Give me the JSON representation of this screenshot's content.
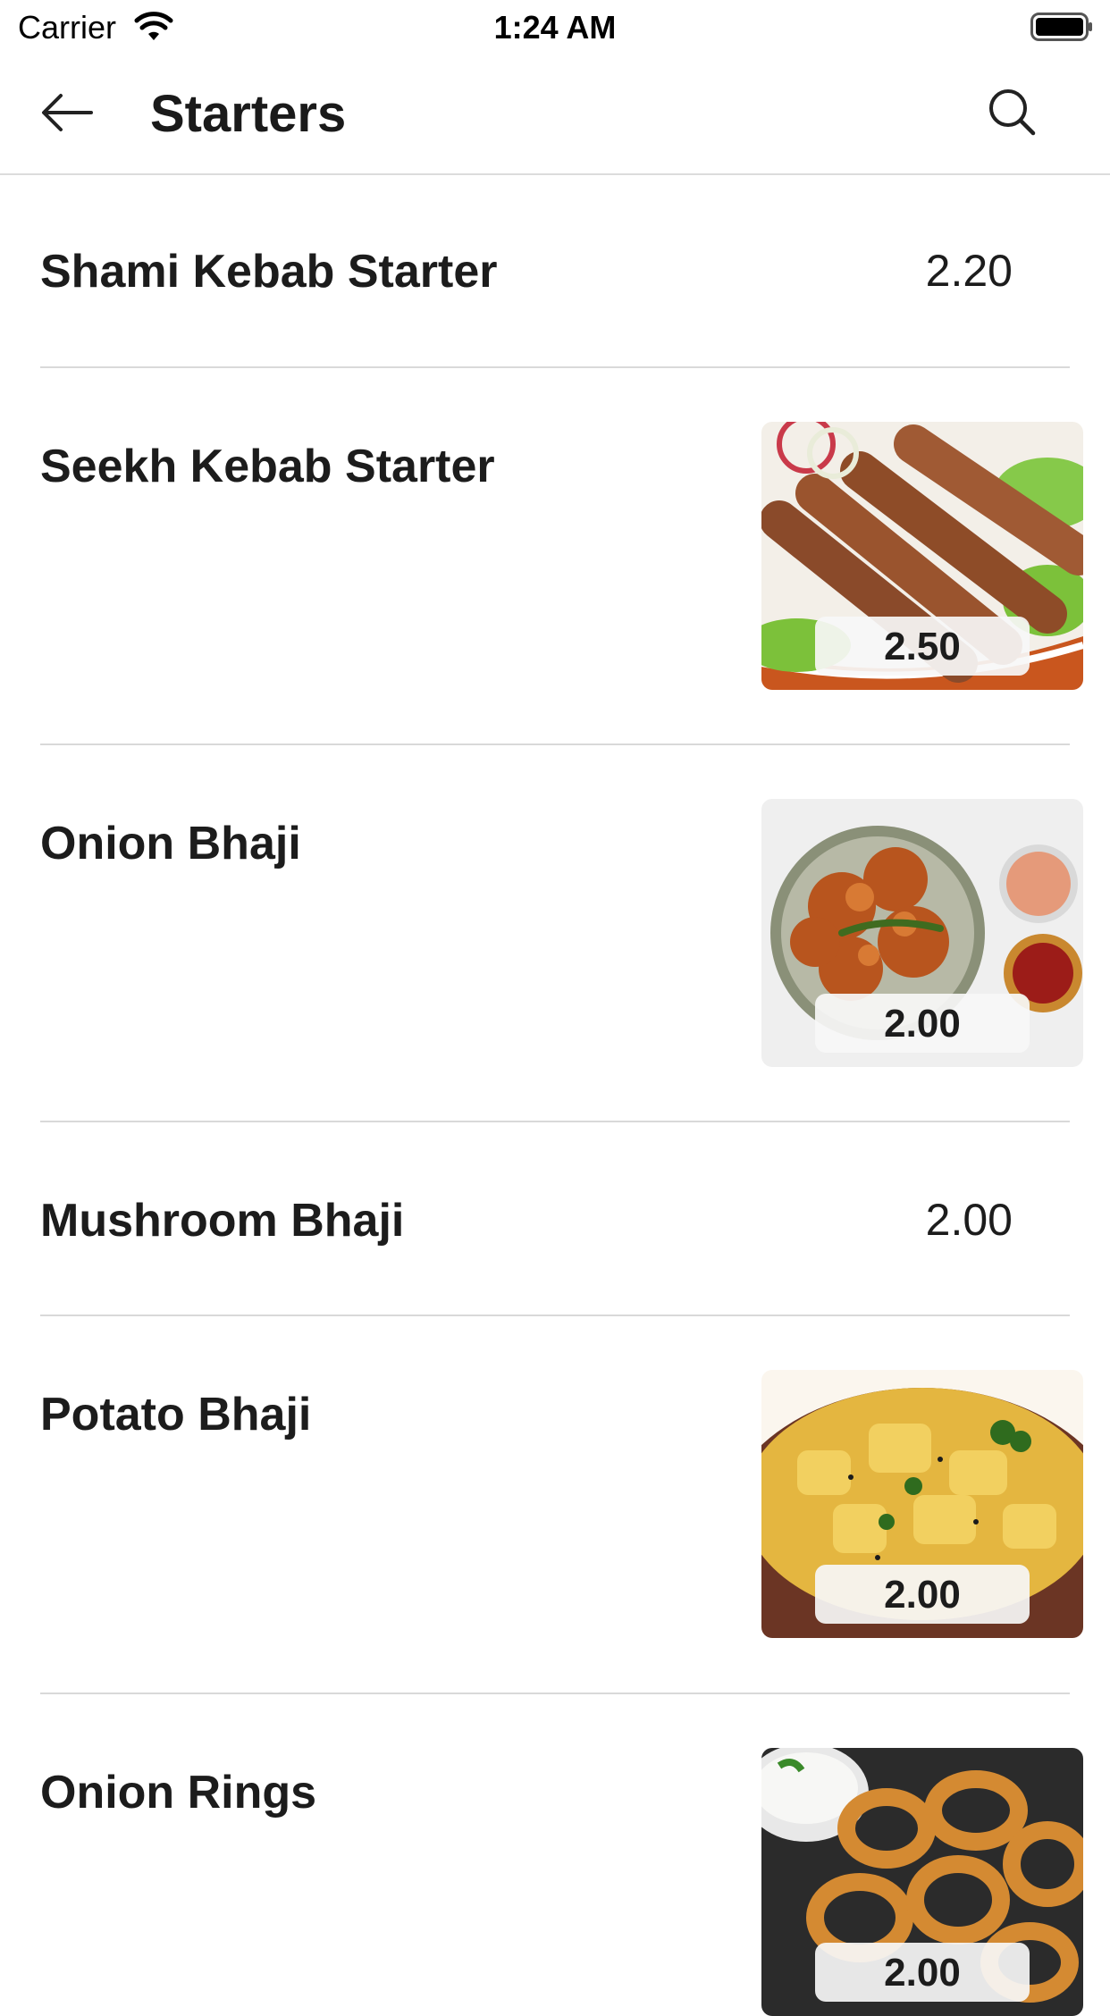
{
  "status_bar": {
    "carrier": "Carrier",
    "time": "1:24 AM"
  },
  "header": {
    "title": "Starters"
  },
  "items": [
    {
      "name": "Shami Kebab Starter",
      "price": "2.20"
    },
    {
      "name": "Seekh Kebab Starter",
      "price": "2.50"
    },
    {
      "name": "Onion Bhaji",
      "price": "2.00"
    },
    {
      "name": "Mushroom Bhaji",
      "price": "2.00"
    },
    {
      "name": "Potato Bhaji",
      "price": "2.00"
    },
    {
      "name": "Onion Rings",
      "price": "2.00"
    }
  ],
  "icons": [
    "wifi-icon",
    "battery-icon",
    "back-arrow-icon",
    "search-icon"
  ]
}
